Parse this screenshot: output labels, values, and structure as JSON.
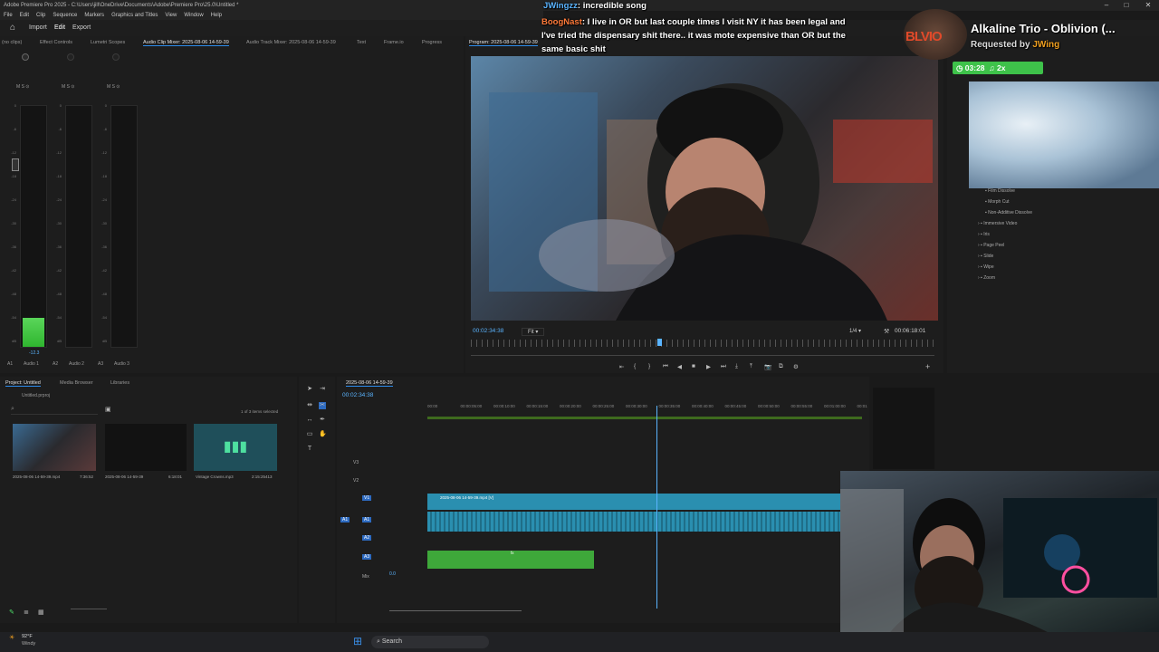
{
  "window": {
    "title": "Adobe Premiere Pro 2025 - C:\\Users\\jill\\OneDrive\\Documents\\Adobe\\Premiere Pro\\25.0\\Untitled *",
    "controls": [
      "–",
      "□",
      "✕"
    ]
  },
  "menu": [
    "File",
    "Edit",
    "Clip",
    "Sequence",
    "Markers",
    "Graphics and Titles",
    "View",
    "Window",
    "Help"
  ],
  "header": {
    "home_icon": "home-icon",
    "import": "Import",
    "edit": "Edit",
    "export": "Export"
  },
  "top_tabs": [
    "(no clips)",
    "Effect Controls",
    "Lumetri Scopes",
    "Audio Clip Mixer: 2025-08-06 14-59-39",
    "Audio Track Mixer: 2025-08-06 14-59-39",
    "Text",
    "Frame.io",
    "Progress"
  ],
  "mixer": {
    "channels": [
      "A1",
      "A2",
      "A3"
    ],
    "channel_names": [
      "Audio 1",
      "Audio 2",
      "Audio 3"
    ],
    "ms_labels": [
      "M",
      "S",
      "⊙"
    ],
    "scale": [
      "0",
      "-6",
      "-12",
      "-18",
      "-24",
      "-30",
      "-36",
      "-42",
      "-48",
      "-54",
      "dB"
    ],
    "reading": "-12.3",
    "levels": [
      0.12,
      0,
      0
    ]
  },
  "program": {
    "tab": "Program: 2025-08-06 14-59-39",
    "timecode": "00:02:34:38",
    "fit": "Fit",
    "resolution": "1/4",
    "duration": "00:06:18:01",
    "playhead_fraction": 0.4,
    "controls": [
      "⇤",
      "{",
      "}",
      "⏮",
      "◀",
      "■",
      "▶",
      "⏭",
      "⤓",
      "⤒",
      "📷",
      "⧉",
      "⚙"
    ]
  },
  "chat": {
    "line1_user": "JWingzz",
    "line1_text": ": incredible song",
    "line2_user": "BoogNast",
    "line2_text": ": I live in OR but last couple times I visit NY it has been legal and I've tried the dispensary shit there.. it was mote expensive than OR but the same basic shit"
  },
  "now_playing": {
    "song": "Alkaline Trio - Oblivion (...",
    "requested_by_label": "Requested by",
    "requester": "JWing",
    "time": "03:28",
    "badge": "2x",
    "logo": "BLVIO"
  },
  "effects": {
    "items": [
      "Film Dissolve",
      "Morph Cut",
      "Non-Additive Dissolve",
      "Immersive Video",
      "Iris",
      "Page Peel",
      "Slide",
      "Wipe",
      "Zoom"
    ]
  },
  "project": {
    "tabs": [
      "Project: Untitled",
      "Media Browser",
      "Libraries"
    ],
    "file": "Untitled.prproj",
    "selected": "1 of 3 items selected",
    "items": [
      {
        "name": "2025-08-06 14-59-39.mp4",
        "duration": "7:36:52"
      },
      {
        "name": "2025-08-06 14-59-39",
        "duration": "6:18:01"
      },
      {
        "name": "Vintage Crowns.mp3",
        "duration": "2:15:25413"
      }
    ]
  },
  "sequence": {
    "tab": "2025-08-06 14-59-39",
    "timecode": "00:02:34:38",
    "ruler": [
      "00:00",
      "00:00:05:00",
      "00:00:10:00",
      "00:00:15:00",
      "00:00:20:00",
      "00:00:25:00",
      "00:00:30:00",
      "00:00:35:00",
      "00:00:40:00",
      "00:00:45:00",
      "00:00:50:00",
      "00:00:55:00",
      "00:01:00:00",
      "00:01"
    ],
    "video_tracks": [
      "V3",
      "V2",
      "V1"
    ],
    "audio_tracks": [
      "A1",
      "A2",
      "A3"
    ],
    "mix": "Mix",
    "mix_value": "0.0",
    "clip_label": "2025-08-06 14-59-39.mp4 [V]",
    "audio_clip_label": "fx"
  },
  "taskbar": {
    "weather_temp": "92°F",
    "weather_desc": "Windy",
    "search": "Search"
  }
}
